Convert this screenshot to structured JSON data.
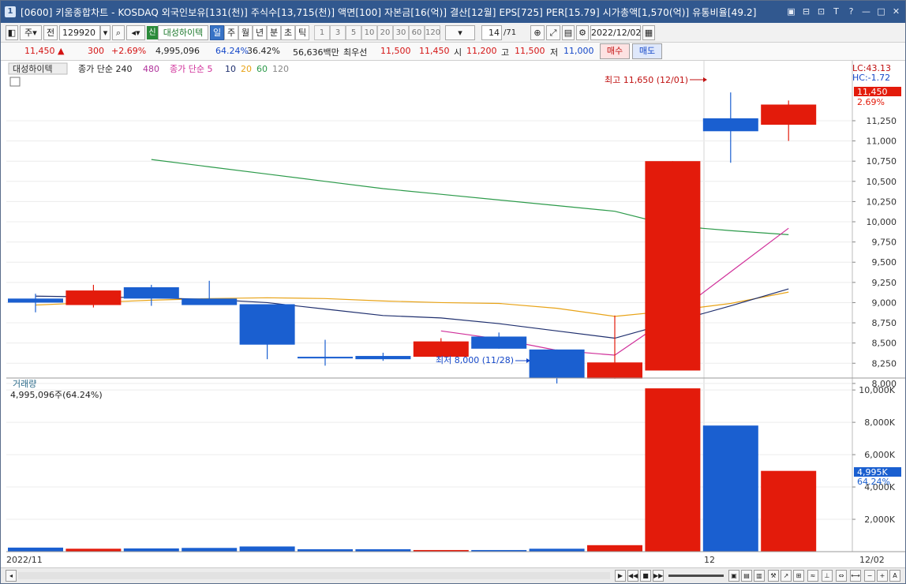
{
  "window": {
    "badge": "1",
    "title": "[0600] 키움종합차트 - KOSDAQ 외국인보유[131(천)] 주식수[13,715(천)] 액면[100] 자본금[16(억)] 결산[12월] EPS[725] PER[15.79] 시가총액[1,570(억)] 유통비율[49.2]",
    "buttons": [
      "▣",
      "⊟",
      "⊡",
      "T",
      "?",
      "—",
      "□",
      "✕"
    ]
  },
  "toolbar": {
    "week_label": "주",
    "prev_label": "전",
    "code": "129920",
    "stock_badge": "신",
    "stock_name": "대성하이텍",
    "periods": [
      "일",
      "주",
      "월",
      "년",
      "분",
      "초",
      "틱"
    ],
    "active_period": "일",
    "tick_values": [
      "1",
      "3",
      "5",
      "10",
      "20",
      "30",
      "60",
      "120"
    ],
    "count": "14",
    "total": "/71",
    "date": "2022/12/02"
  },
  "quote": {
    "price": "11,450",
    "change": "300",
    "change_pct": "+2.69%",
    "volume": "4,995,096",
    "vol_ratio": "64.24%",
    "turnover": "36.42%",
    "amount": "56,636백만",
    "best_label": "최우선",
    "best_ask": "11,500",
    "best_bid": "11,450",
    "open_label": "시",
    "open": "11,200",
    "high_label": "고",
    "high": "11,500",
    "low_label": "저",
    "low": "11,000",
    "buy_label": "매수",
    "sell_label": "매도"
  },
  "legend": {
    "stock_tab": "대성하이텍",
    "ma_long": "종가 단순 240",
    "ma_long_2": "480",
    "ma_short": "종가 단순 5",
    "ma_10": "10",
    "ma_20": "20",
    "ma_60": "60",
    "ma_120": "120"
  },
  "right_info": {
    "lc": "LC:43.13",
    "hc": "HC:-1.72",
    "last_price": "11,450",
    "last_pct": "2.69%",
    "vol_last": "4,995K",
    "vol_pct": "64.24%"
  },
  "annotations": {
    "high": "최고 11,650 (12/01)",
    "low": "최저 8,000 (11/28)"
  },
  "volume_panel": {
    "title": "거래량",
    "value": "4,995,096주(64.24%)"
  },
  "dates": {
    "start": "2022/11",
    "mid": "12",
    "end": "12/02"
  },
  "colors": {
    "up": "#e31b0b",
    "down": "#1a5fd0",
    "ma5": "#d0309a",
    "ma10": "#1f2f6e",
    "ma20": "#e8a317",
    "ma60": "#2c9a4a",
    "title_bar": "#31588f"
  },
  "chart_data": {
    "type": "candlestick",
    "price_axis": {
      "min": 7950,
      "max": 11650,
      "ticks": [
        8000,
        8250,
        8500,
        8750,
        9000,
        9250,
        9500,
        9750,
        10000,
        10250,
        10500,
        10750,
        11000,
        11250
      ]
    },
    "volume_axis": {
      "min": 0,
      "max": 10000,
      "unit": "K",
      "ticks": [
        2000,
        4000,
        6000,
        8000,
        10000
      ]
    },
    "candles": [
      {
        "open": 9050,
        "close": 9000,
        "high": 9110,
        "low": 8880
      },
      {
        "open": 8970,
        "close": 9150,
        "high": 9220,
        "low": 8940
      },
      {
        "open": 9190,
        "close": 9050,
        "high": 9220,
        "low": 8960
      },
      {
        "open": 9050,
        "close": 8970,
        "high": 9270,
        "low": 8970
      },
      {
        "open": 8980,
        "close": 8480,
        "high": 8980,
        "low": 8300
      },
      {
        "open": 8330,
        "close": 8310,
        "high": 8540,
        "low": 8220
      },
      {
        "open": 8340,
        "close": 8300,
        "high": 8380,
        "low": 8280
      },
      {
        "open": 8330,
        "close": 8520,
        "high": 8560,
        "low": 8330
      },
      {
        "open": 8580,
        "close": 8430,
        "high": 8630,
        "low": 8430
      },
      {
        "open": 8420,
        "close": 8070,
        "high": 8420,
        "low": 8000
      },
      {
        "open": 8060,
        "close": 8260,
        "high": 8840,
        "low": 8060
      },
      {
        "open": 8160,
        "close": 10750,
        "high": 10750,
        "low": 8160
      },
      {
        "open": 11280,
        "close": 11120,
        "high": 11600,
        "low": 10730
      },
      {
        "open": 11200,
        "close": 11450,
        "high": 11500,
        "low": 11000
      }
    ],
    "volume": [
      250,
      180,
      200,
      230,
      320,
      150,
      150,
      100,
      100,
      180,
      400,
      10100,
      7800,
      4995
    ],
    "ma5": [
      null,
      null,
      null,
      null,
      null,
      null,
      null,
      8650,
      8550,
      8410,
      8350,
      8840,
      9380,
      9920
    ],
    "ma10": [
      9080,
      9070,
      9060,
      9040,
      9000,
      8920,
      8840,
      8810,
      8740,
      8650,
      8560,
      8760,
      8960,
      9170
    ],
    "ma20": [
      8970,
      9000,
      9030,
      9050,
      9060,
      9050,
      9020,
      9000,
      8990,
      8930,
      8830,
      8900,
      8990,
      9130
    ],
    "ma60": [
      null,
      null,
      10770,
      10680,
      10590,
      10500,
      10410,
      10340,
      10270,
      10200,
      10130,
      9950,
      9890,
      9840
    ]
  }
}
